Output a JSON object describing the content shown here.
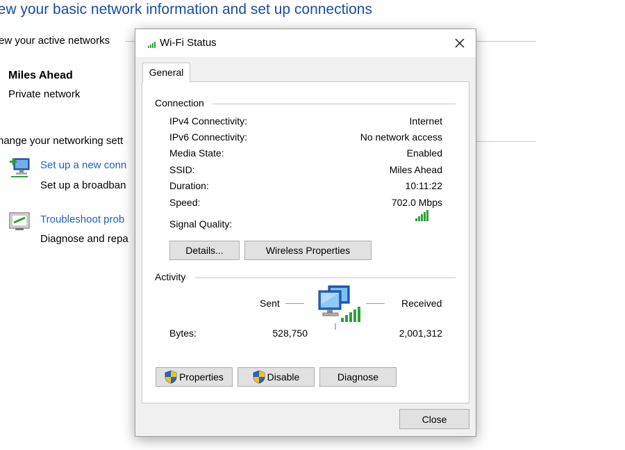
{
  "background": {
    "title": "iew your basic network information and set up connections",
    "active_networks_label": "ew your active networks",
    "network_name": "Miles Ahead",
    "network_type": "Private network",
    "change_settings_label": "hange your networking sett",
    "setup_link": "Set up a new conn",
    "setup_desc": "Set up a broadban",
    "troubleshoot_link": "Troubleshoot prob",
    "troubleshoot_desc": "Diagnose and repa"
  },
  "dialog": {
    "title": "Wi-Fi Status",
    "tab": "General",
    "connection": {
      "label": "Connection",
      "rows": [
        {
          "label": "IPv4 Connectivity:",
          "value": "Internet"
        },
        {
          "label": "IPv6 Connectivity:",
          "value": "No network access"
        },
        {
          "label": "Media State:",
          "value": "Enabled"
        },
        {
          "label": "SSID:",
          "value": "Miles Ahead"
        },
        {
          "label": "Duration:",
          "value": "10:11:22"
        },
        {
          "label": "Speed:",
          "value": "702.0 Mbps"
        }
      ],
      "signal_label": "Signal Quality:",
      "signal_bars_filled": 5,
      "signal_bars_total": 5,
      "details_button": "Details...",
      "wireless_button": "Wireless Properties"
    },
    "activity": {
      "label": "Activity",
      "sent_label": "Sent",
      "received_label": "Received",
      "bytes_label": "Bytes:",
      "bytes_sent": "528,750",
      "bytes_received": "2,001,312"
    },
    "buttons": {
      "properties": "Properties",
      "disable": "Disable",
      "diagnose": "Diagnose",
      "close": "Close"
    }
  },
  "colors": {
    "accent_blue": "#1a4ca3",
    "link_blue": "#1a62c4",
    "signal_green": "#2ea03a",
    "shield_blue": "#2b63c2",
    "shield_yellow": "#f2c21b"
  }
}
